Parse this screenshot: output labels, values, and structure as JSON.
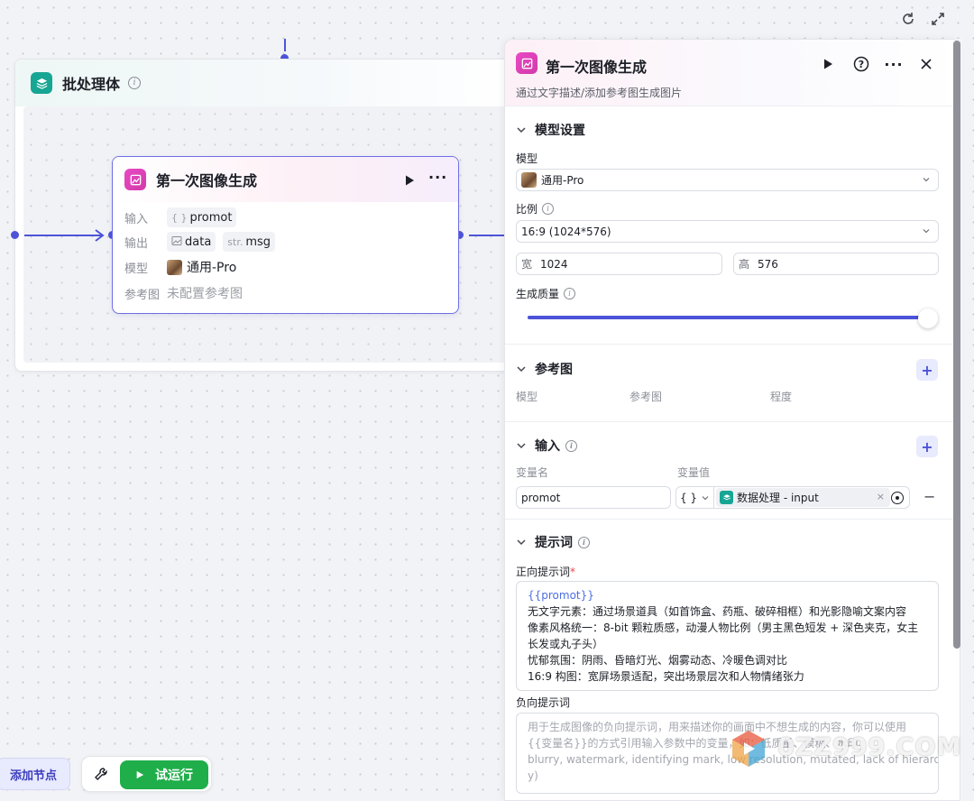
{
  "batch": {
    "title": "批处理体"
  },
  "node": {
    "title": "第一次图像生成",
    "input_label": "输入",
    "input_var": "promot",
    "output_label": "输出",
    "output_data": "data",
    "output_str_prefix": "str.",
    "output_msg": "msg",
    "model_label": "模型",
    "model_value": "通用-Pro",
    "ref_label": "参考图",
    "ref_value": "未配置参考图"
  },
  "toolbar": {
    "add_node": "添加节点",
    "run": "试运行"
  },
  "panel": {
    "title": "第一次图像生成",
    "description": "通过文字描述/添加参考图生成图片",
    "model_settings": {
      "title": "模型设置",
      "model_label": "模型",
      "model_value": "通用-Pro",
      "ratio_label": "比例",
      "ratio_value": "16:9 (1024*576)",
      "width_label": "宽",
      "width_value": "1024",
      "height_label": "高",
      "height_value": "576",
      "quality_label": "生成质量",
      "quality_level": 1.0
    },
    "reference": {
      "title": "参考图",
      "col_model": "模型",
      "col_ref": "参考图",
      "col_degree": "程度"
    },
    "inputs": {
      "title": "输入",
      "col_name": "变量名",
      "col_value": "变量值",
      "var_name": "promot",
      "var_type": "{ }",
      "var_source": "数据处理 - input"
    },
    "prompt": {
      "title": "提示词",
      "positive_label": "正向提示词",
      "required_mark": "*",
      "positive_lines": [
        "{{promot}}",
        "无文字元素：通过场景道具（如首饰盒、药瓶、破碎相框）和光影隐喻文案内容",
        "像素风格统一：8-bit 颗粒质感，动漫人物比例（男主黑色短发 + 深色夹克，女主",
        "长发或丸子头）",
        "忧郁氛围：阴雨、昏暗灯光、烟雾动态、冷暖色调对比",
        "16:9 构图：宽屏场景适配，突出场景层次和人物情绪张力"
      ],
      "negative_label": "负向提示词",
      "negative_placeholder_lines": [
        "用于生成图像的负向提示词，用来描述你的画面中不想生成的内容，你可以使用",
        "{{变量名}}的方式引用输入参数中的变量，如：低质量、模糊、水印、",
        "blurry, watermark, identifying mark, low resolution, mutated, lack of hierarch",
        "y)"
      ]
    }
  },
  "watermark": "0ZZ999.COM",
  "colors": {
    "accent": "#4d53d8",
    "teal": "#17a594",
    "pink": "#e04ac0",
    "run_green": "#1fae4a"
  }
}
